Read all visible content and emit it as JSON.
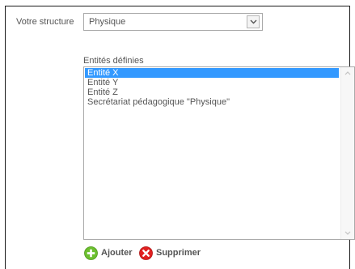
{
  "structure": {
    "label": "Votre structure",
    "selected_value": "Physique"
  },
  "entities": {
    "label": "Entités définies",
    "items": [
      {
        "label": "Entité X",
        "selected": true
      },
      {
        "label": "Entité Y",
        "selected": false
      },
      {
        "label": "Entité Z",
        "selected": false
      },
      {
        "label": "Secrétariat pédagogique \"Physique\"",
        "selected": false
      }
    ]
  },
  "actions": {
    "add_label": "Ajouter",
    "delete_label": "Supprimer"
  },
  "colors": {
    "selection": "#3399ff",
    "add_icon": "#6cbf2f",
    "delete_icon": "#e02020"
  },
  "icons": {
    "select_arrow": "chevron-down-icon",
    "add": "plus-circle-icon",
    "delete": "x-circle-icon"
  }
}
